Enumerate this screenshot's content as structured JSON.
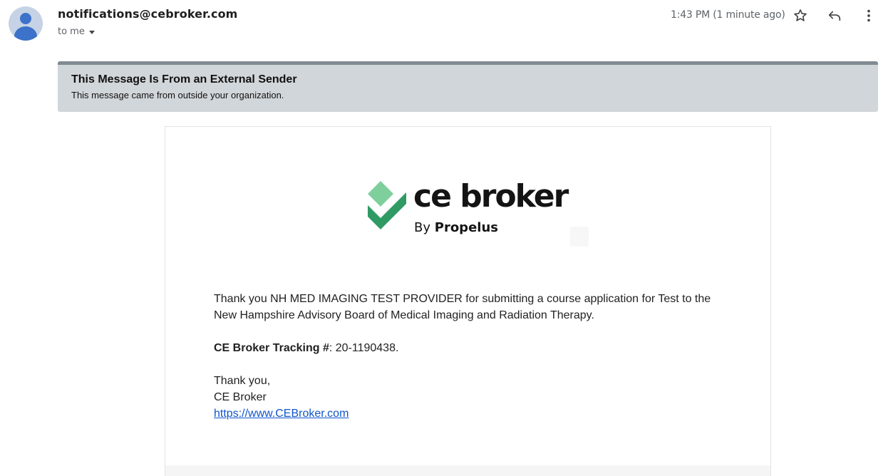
{
  "header": {
    "sender": "notifications@cebroker.com",
    "recipient_label": "to me",
    "time": "1:43 PM (1 minute ago)",
    "icons": {
      "avatar": "person-icon",
      "star": "star-icon",
      "reply": "reply-icon",
      "more": "more-vert-icon",
      "recipient_toggle": "caret-down-icon"
    }
  },
  "banner": {
    "title": "This Message Is From an External Sender",
    "subtitle": "This message came from outside your organization."
  },
  "email": {
    "logo": {
      "wordmark": "ce broker",
      "by": "By",
      "brand": "Propelus"
    },
    "paragraph1": "Thank you NH MED IMAGING TEST PROVIDER for submitting a course application for Test to the New Hampshire Advisory Board of Medical Imaging and Radiation Therapy.",
    "tracking_label": "CE Broker Tracking #",
    "tracking_value": ": 20-1190438.",
    "signoff": "Thank you,",
    "signature": "CE Broker",
    "link_text": "https://www.CEBroker.com"
  },
  "colors": {
    "banner_bg": "#d1d6da",
    "banner_border": "#808b93",
    "link": "#1155cc",
    "logo_green_light": "#7fcf9c",
    "logo_green_dark": "#2f9a64",
    "avatar_blue": "#3c72c9"
  }
}
